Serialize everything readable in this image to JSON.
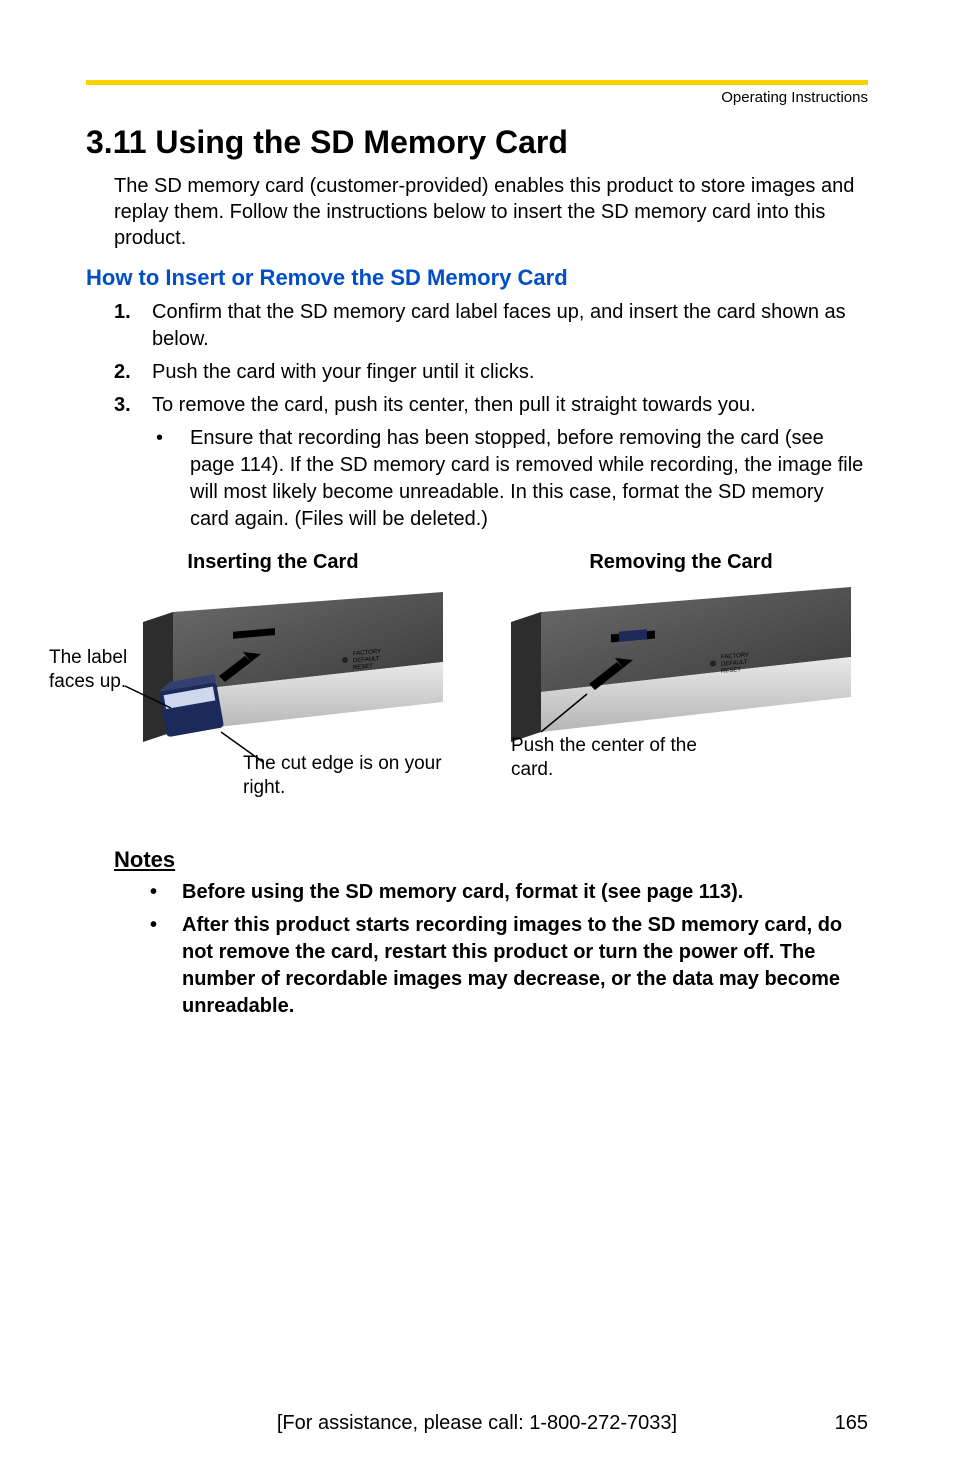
{
  "running_head": "Operating Instructions",
  "section_title": "3.11  Using the SD Memory Card",
  "intro_text": "The SD memory card (customer-provided) enables this product to store images and replay them. Follow the instructions below to insert the SD memory card into this product.",
  "sub_heading": "How to Insert or Remove the SD Memory Card",
  "steps": [
    {
      "num": "1.",
      "text": "Confirm that the SD memory card label faces up, and insert the card shown as below."
    },
    {
      "num": "2.",
      "text": "Push the card with your finger until it clicks."
    },
    {
      "num": "3.",
      "text": "To remove the card, push its center, then pull it straight towards you."
    }
  ],
  "sub_bullet_dot": "•",
  "sub_bullet_text": "Ensure that recording has been stopped, before removing the card (see page 114). If the SD memory card is removed while recording, the image file will most likely become unreadable. In this case, format the SD memory card again. (Files will be deleted.)",
  "fig_insert_caption": "Inserting the Card",
  "fig_remove_caption": "Removing the Card",
  "label_up": "The label faces up.",
  "label_cut": "The cut edge is on your right.",
  "label_center": "Push the center of the card.",
  "notes_heading": "Notes",
  "notes": [
    {
      "dot": "•",
      "text": "Before using the SD memory card, format it (see page 113)."
    },
    {
      "dot": "•",
      "text": "After this product starts recording images to the SD memory card, do not remove the card, restart this product or turn the power off. The number of recordable images may decrease, or the data may become unreadable."
    }
  ],
  "footer_center": "[For assistance, please call: 1-800-272-7033]",
  "page_number": "165"
}
